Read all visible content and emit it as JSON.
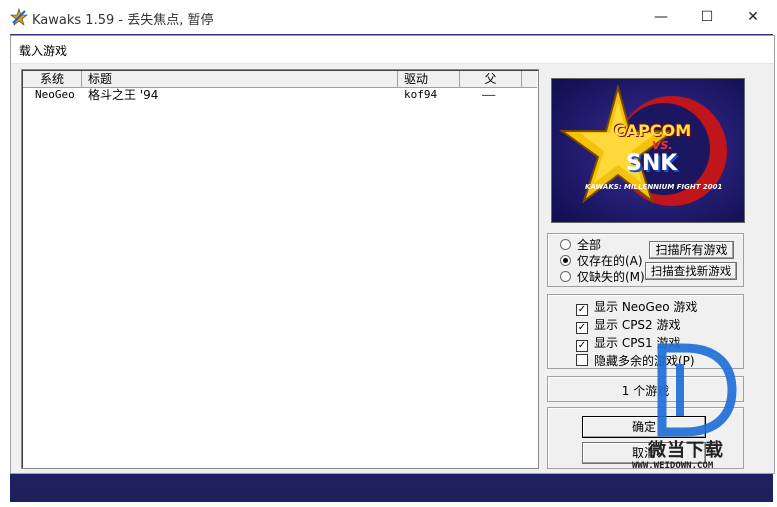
{
  "window": {
    "title": "Kawaks 1.59 - 丢失焦点, 暂停",
    "minimize_glyph": "—",
    "maximize_glyph": "☐",
    "close_glyph": "✕"
  },
  "dialog": {
    "title": "载入游戏",
    "list": {
      "columns": [
        "系统",
        "标题",
        "驱动",
        "父"
      ],
      "rows": [
        {
          "system": "NeoGeo",
          "title": "格斗之王 '94",
          "driver": "kof94",
          "parent": "——"
        }
      ]
    },
    "logo": {
      "line1": "CAPCOM",
      "line2": "VS.",
      "line3": "SNK",
      "caption": "KAWAKS: MILLENNIUM FIGHT 2001"
    },
    "filter": {
      "options": [
        {
          "label": "全部",
          "selected": false
        },
        {
          "label": "仅存在的(A)",
          "selected": true
        },
        {
          "label": "仅缺失的(M)",
          "selected": false
        }
      ],
      "scan_all_label": "扫描所有游戏",
      "scan_new_label": "扫描查找新游戏"
    },
    "show_options": [
      {
        "label": "显示 NeoGeo 游戏",
        "checked": true
      },
      {
        "label": "显示 CPS2 游戏",
        "checked": true
      },
      {
        "label": "显示 CPS1 游戏",
        "checked": true
      },
      {
        "label": "隐藏多余的游戏(P)",
        "checked": false
      }
    ],
    "count_text": "1 个游戏",
    "ok_label": "确定",
    "cancel_label": "取消"
  },
  "watermark": {
    "brand": "微当下载",
    "url": "WWW.WEIDOWN.COM"
  },
  "colors": {
    "client_bg": "#2b2a78",
    "dialog_bg": "#f0f0f0",
    "watermark": "#1e6fd9"
  }
}
